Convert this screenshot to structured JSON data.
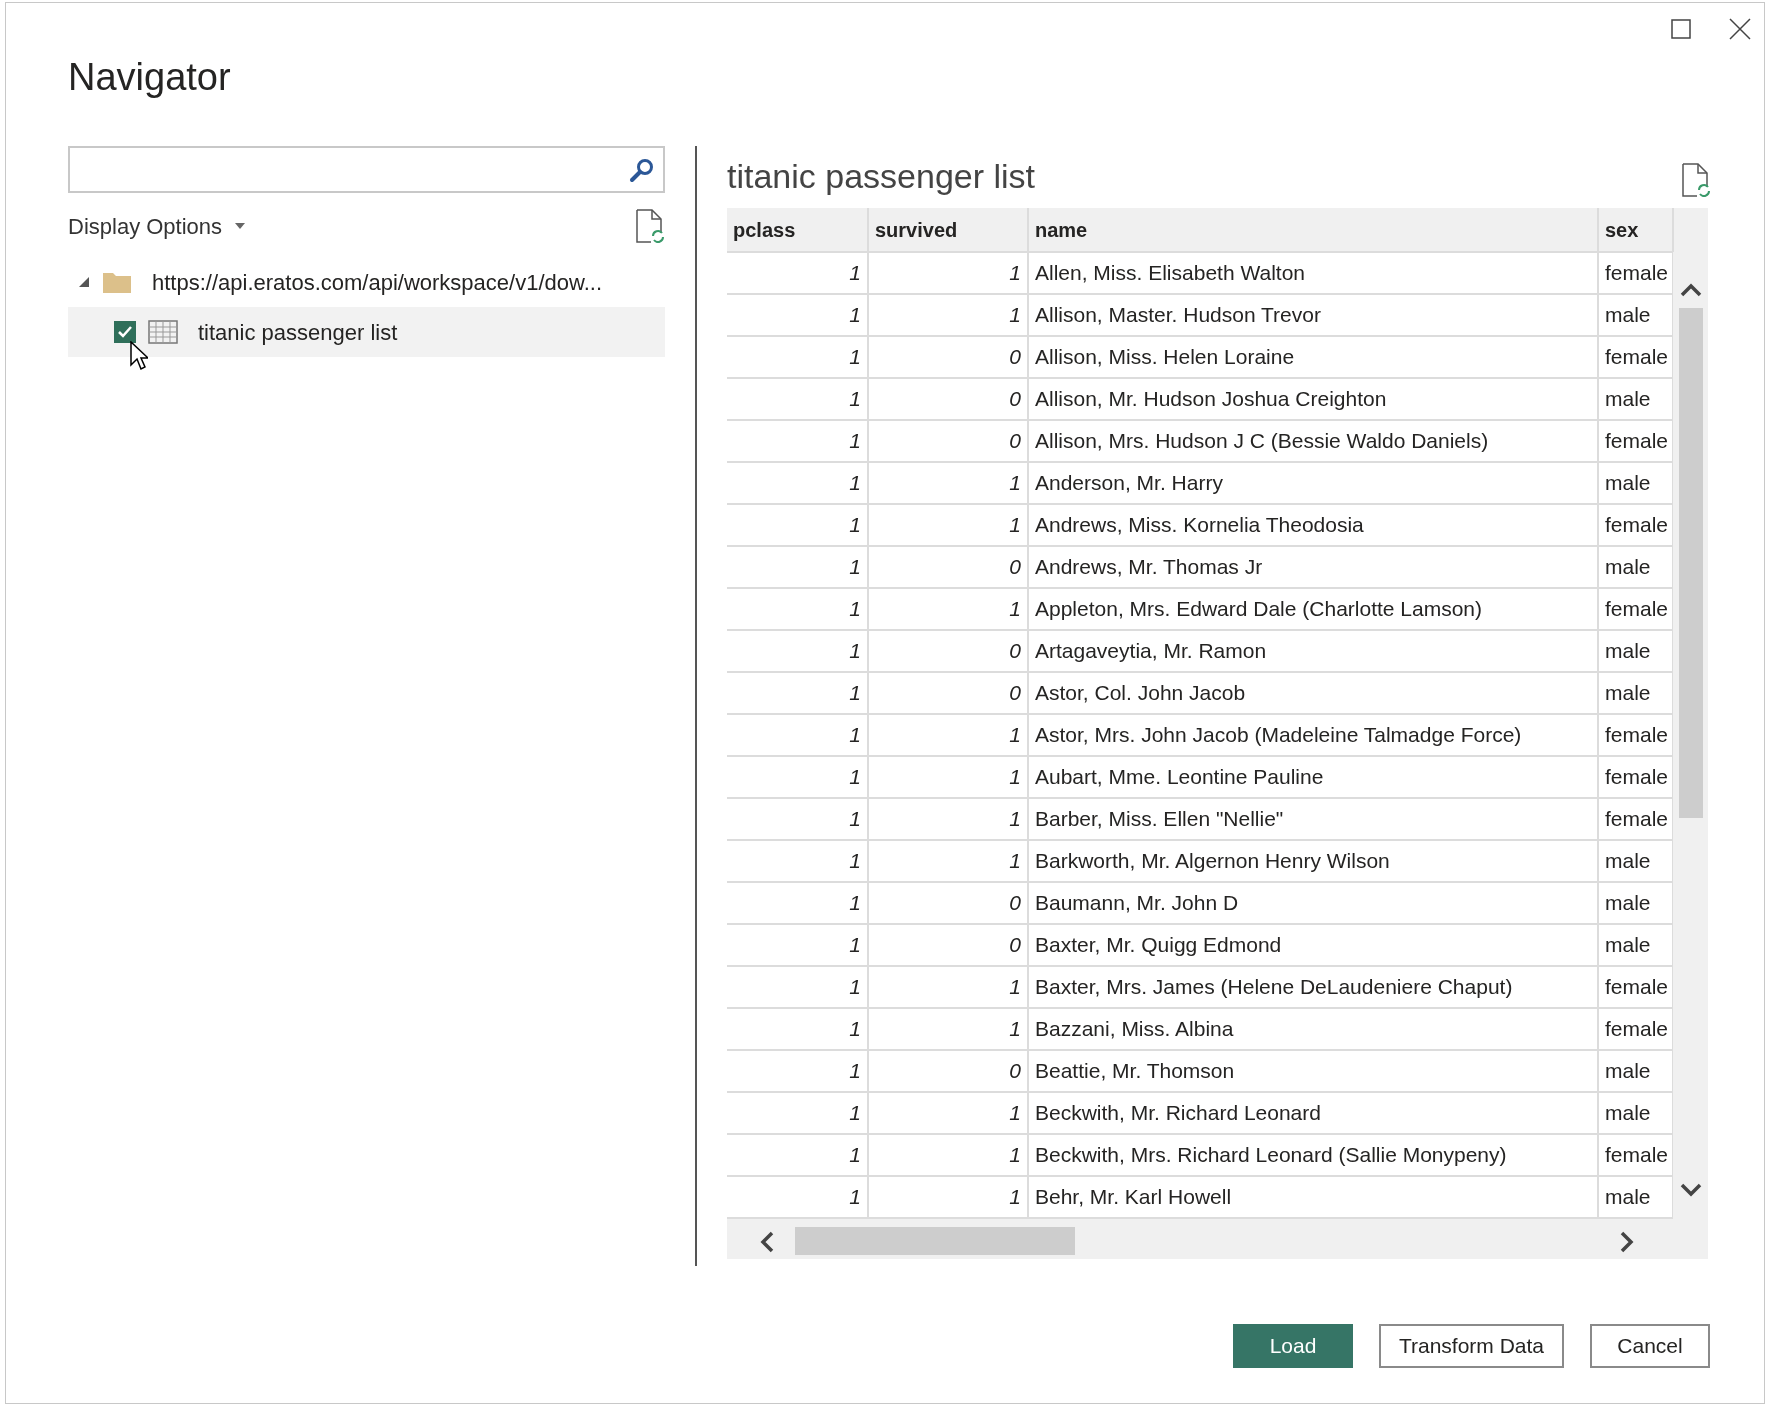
{
  "window": {
    "title": "Navigator"
  },
  "display_options": {
    "label": "Display Options"
  },
  "tree": [
    {
      "label": "https://api.eratos.com/api/workspace/v1/dow...",
      "kind": "folder",
      "expanded": true,
      "children": [
        {
          "label": "titanic passenger list",
          "kind": "table",
          "checked": true,
          "selected": true
        }
      ]
    }
  ],
  "preview": {
    "title": "titanic passenger list",
    "table": {
      "columns": [
        "pclass",
        "survived",
        "name",
        "sex"
      ],
      "rows": [
        [
          "1",
          "1",
          "Allen, Miss. Elisabeth Walton",
          "female"
        ],
        [
          "1",
          "1",
          "Allison, Master. Hudson Trevor",
          "male"
        ],
        [
          "1",
          "0",
          "Allison, Miss. Helen Loraine",
          "female"
        ],
        [
          "1",
          "0",
          "Allison, Mr. Hudson Joshua Creighton",
          "male"
        ],
        [
          "1",
          "0",
          "Allison, Mrs. Hudson J C (Bessie Waldo Daniels)",
          "female"
        ],
        [
          "1",
          "1",
          "Anderson, Mr. Harry",
          "male"
        ],
        [
          "1",
          "1",
          "Andrews, Miss. Kornelia Theodosia",
          "female"
        ],
        [
          "1",
          "0",
          "Andrews, Mr. Thomas Jr",
          "male"
        ],
        [
          "1",
          "1",
          "Appleton, Mrs. Edward Dale (Charlotte Lamson)",
          "female"
        ],
        [
          "1",
          "0",
          "Artagaveytia, Mr. Ramon",
          "male"
        ],
        [
          "1",
          "0",
          "Astor, Col. John Jacob",
          "male"
        ],
        [
          "1",
          "1",
          "Astor, Mrs. John Jacob (Madeleine Talmadge Force)",
          "female"
        ],
        [
          "1",
          "1",
          "Aubart, Mme. Leontine Pauline",
          "female"
        ],
        [
          "1",
          "1",
          "Barber, Miss. Ellen \"Nellie\"",
          "female"
        ],
        [
          "1",
          "1",
          "Barkworth, Mr. Algernon Henry Wilson",
          "male"
        ],
        [
          "1",
          "0",
          "Baumann, Mr. John D",
          "male"
        ],
        [
          "1",
          "0",
          "Baxter, Mr. Quigg Edmond",
          "male"
        ],
        [
          "1",
          "1",
          "Baxter, Mrs. James (Helene DeLaudeniere Chaput)",
          "female"
        ],
        [
          "1",
          "1",
          "Bazzani, Miss. Albina",
          "female"
        ],
        [
          "1",
          "0",
          "Beattie, Mr. Thomson",
          "male"
        ],
        [
          "1",
          "1",
          "Beckwith, Mr. Richard Leonard",
          "male"
        ],
        [
          "1",
          "1",
          "Beckwith, Mrs. Richard Leonard (Sallie Monypeny)",
          "female"
        ],
        [
          "1",
          "1",
          "Behr, Mr. Karl Howell",
          "male"
        ]
      ]
    }
  },
  "buttons": [
    {
      "label": "Load",
      "kind": "primary"
    },
    {
      "label": "Transform Data",
      "kind": "secondary"
    },
    {
      "label": "Cancel",
      "kind": "secondary"
    }
  ]
}
